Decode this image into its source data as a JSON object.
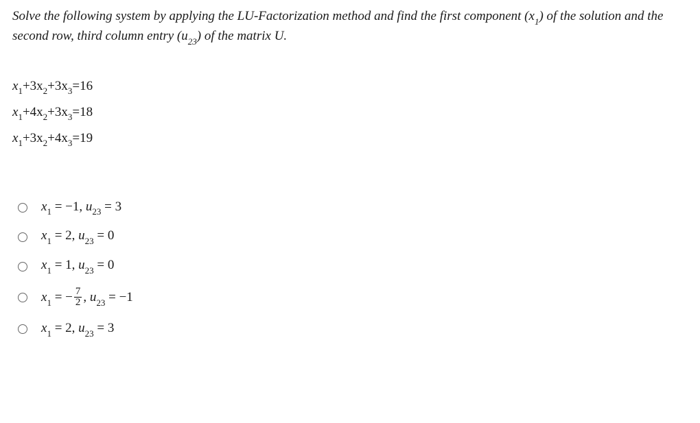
{
  "prompt": {
    "part1": "Solve the following system by applying the LU-Factorization method and find the first component (",
    "x1": "x",
    "x1sub": "1",
    "part2": ") of the solution and the second row, third column entry (u",
    "u23sub": "23",
    "part3": ") of the matrix U."
  },
  "equations": [
    {
      "t1": "x",
      "s1": "1",
      "t2": "+3x",
      "s2": "2",
      "t3": "+3x",
      "s3": "3",
      "t4": "=16"
    },
    {
      "t1": "x",
      "s1": "1",
      "t2": "+4x",
      "s2": "2",
      "t3": "+3x",
      "s3": "3",
      "t4": "=18"
    },
    {
      "t1": "x",
      "s1": "1",
      "t2": "+3x",
      "s2": "2",
      "t3": "+4x",
      "s3": "3",
      "t4": "=19"
    }
  ],
  "options": [
    {
      "type": "plain",
      "x1_lhs": "x",
      "x1_sub": "1",
      "eq": " = ",
      "x1_val": "−1, ",
      "u_lhs": "u",
      "u_sub": "23",
      "u_eq": " = ",
      "u_val": "3"
    },
    {
      "type": "plain",
      "x1_lhs": "x",
      "x1_sub": "1",
      "eq": " = ",
      "x1_val": "2, ",
      "u_lhs": "u",
      "u_sub": "23",
      "u_eq": " = ",
      "u_val": "0"
    },
    {
      "type": "plain",
      "x1_lhs": "x",
      "x1_sub": "1",
      "eq": " = ",
      "x1_val": "1, ",
      "u_lhs": "u",
      "u_sub": "23",
      "u_eq": " = ",
      "u_val": "0"
    },
    {
      "type": "frac",
      "x1_lhs": "x",
      "x1_sub": "1",
      "eq": " = −",
      "num": "7",
      "den": "2",
      "after": ", ",
      "u_lhs": "u",
      "u_sub": "23",
      "u_eq": " = ",
      "u_val": "−1"
    },
    {
      "type": "plain",
      "x1_lhs": "x",
      "x1_sub": "1",
      "eq": " = ",
      "x1_val": "2, ",
      "u_lhs": "u",
      "u_sub": "23",
      "u_eq": " = ",
      "u_val": "3"
    }
  ]
}
